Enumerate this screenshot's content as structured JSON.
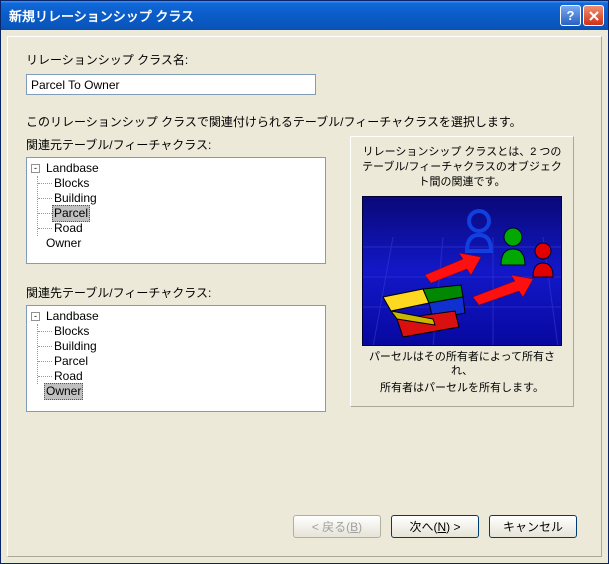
{
  "title": "新規リレーションシップ クラス",
  "labels": {
    "class_name": "リレーションシップ クラス名:",
    "instruction": "このリレーションシップ クラスで関連付けられるテーブル/フィーチャクラスを選択します。",
    "origin_label": "関連元テーブル/フィーチャクラス:",
    "dest_label": "関連先テーブル/フィーチャクラス:"
  },
  "class_name_value": "Parcel To Owner",
  "tree_origin": {
    "root": "Landbase",
    "children": [
      "Blocks",
      "Building",
      "Parcel",
      "Road"
    ],
    "selected": "Parcel",
    "sibling": "Owner",
    "sibling_selected": false
  },
  "tree_dest": {
    "root": "Landbase",
    "children": [
      "Blocks",
      "Building",
      "Parcel",
      "Road"
    ],
    "selected": "",
    "sibling": "Owner",
    "sibling_selected": true
  },
  "info": {
    "top": "リレーションシップ クラスとは、2 つのテーブル/フィーチャクラスのオブジェクト間の関連です。",
    "bottom1": "パーセルはその所有者によって所有され、",
    "bottom2": "所有者はパーセルを所有します。"
  },
  "buttons": {
    "back": "< 戻る",
    "back_m": "B",
    "next": "次へ",
    "next_m": "N",
    "next_suffix": " >",
    "cancel": "キャンセル"
  }
}
